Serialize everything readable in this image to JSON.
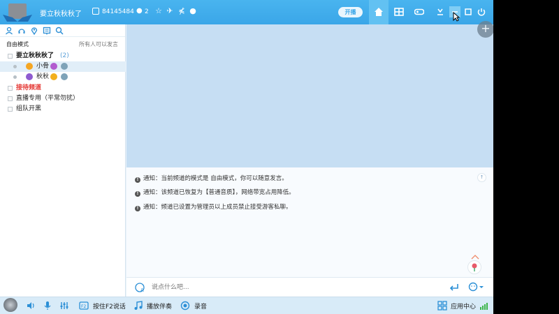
{
  "titlebar": {
    "channel_name": "要立秋秋秋了",
    "channel_id": "84145484",
    "online_count": "2",
    "live_pill": "开播"
  },
  "left": {
    "mode_label": "自由模式",
    "mode_right": "所有人可以发言",
    "tree": {
      "root": {
        "name": "要立秋秋秋了",
        "count": "(2)"
      },
      "members": [
        {
          "name": "小骨"
        },
        {
          "name": "秋秋"
        }
      ],
      "channels": [
        {
          "name": "接待频道",
          "color": "#e53935"
        },
        {
          "name": "直播专用（平常勿扰）",
          "color": "#222222"
        },
        {
          "name": "组队开黑",
          "color": "#222222"
        }
      ]
    }
  },
  "chat": {
    "notices": [
      "通知：当前频道的模式是 自由模式，你可以随意发言。",
      "通知：该频道已恢复为【普通音质】，网络带宽占用降低。",
      "通知：频道已设置为管理员以上成员禁止接受游客私聊。"
    ],
    "input_placeholder": "说点什么吧..."
  },
  "bottombar": {
    "ptt_label": "按住F2说话",
    "accompany_label": "播放伴奏",
    "record_label": "录音",
    "app_center_label": "应用中心"
  },
  "colors": {
    "titlebar": "#3aa6e8",
    "accent_red": "#e53935"
  }
}
